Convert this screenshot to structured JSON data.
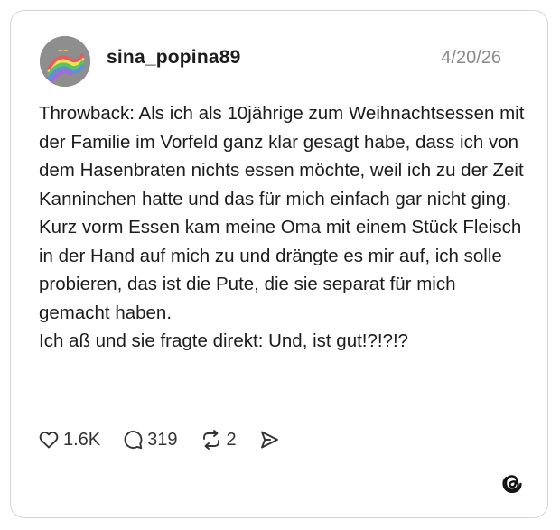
{
  "post": {
    "username": "sina_popina89",
    "timestamp": "4/20/26",
    "paragraphs": [
      "Throwback: Als ich als 10jährige zum Weihnachtsessen mit der Familie im Vorfeld ganz klar gesagt habe, dass ich von dem Hasenbraten nichts essen möchte, weil ich zu der Zeit Kanninchen hatte und das für mich einfach gar nicht ging.",
      "Kurz vorm Essen kam meine Oma mit einem Stück Fleisch in der Hand auf mich zu und drängte es mir auf, ich solle probieren, das ist die Pute, die sie separat für mich gemacht haben.",
      "Ich aß und sie fragte direkt: Und, ist gut!?!?!?"
    ]
  },
  "actions": {
    "likes": "1.6K",
    "replies": "319",
    "reposts": "2"
  },
  "icons": {
    "like": "heart-icon",
    "reply": "comment-bubble-icon",
    "repost": "repost-icon",
    "share": "send-icon",
    "brand": "threads-logo-icon"
  }
}
